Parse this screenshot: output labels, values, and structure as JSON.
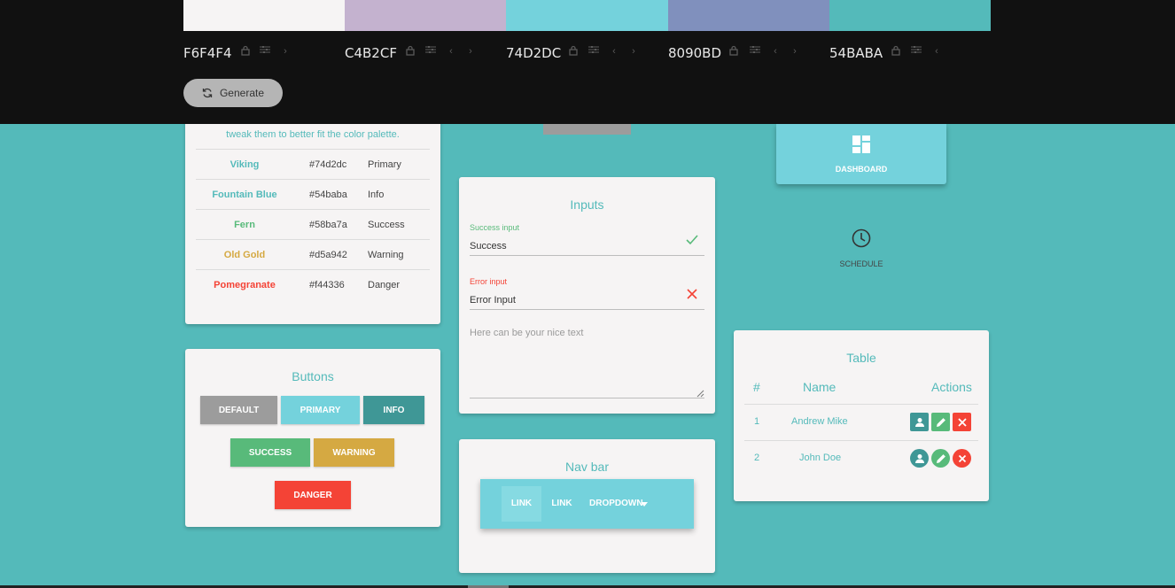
{
  "palette": [
    {
      "hex": "F6F4F4",
      "color": "#F6F4F4"
    },
    {
      "hex": "C4B2CF",
      "color": "#C4B2CF"
    },
    {
      "hex": "74D2DC",
      "color": "#74D2DC"
    },
    {
      "hex": "8090BD",
      "color": "#8090BD"
    },
    {
      "hex": "54BABA",
      "color": "#54BABA"
    }
  ],
  "generate_label": "Generate",
  "colors_card": {
    "intro": "tweak them to better fit the color palette.",
    "rows": [
      {
        "name": "Viking",
        "hex": "#74d2dc",
        "type": "Primary",
        "color": "#54BABA"
      },
      {
        "name": "Fountain Blue",
        "hex": "#54baba",
        "type": "Info",
        "color": "#54BABA"
      },
      {
        "name": "Fern",
        "hex": "#58ba7a",
        "type": "Success",
        "color": "#58BA7A"
      },
      {
        "name": "Old Gold",
        "hex": "#d5a942",
        "type": "Warning",
        "color": "#D5A942"
      },
      {
        "name": "Pomegranate",
        "hex": "#f44336",
        "type": "Danger",
        "color": "#F44336"
      }
    ]
  },
  "buttons_card": {
    "title": "Buttons",
    "default": "Default",
    "primary": "Primary",
    "info": "Info",
    "success": "Success",
    "warning": "Warning",
    "danger": "Danger"
  },
  "inputs_card": {
    "title": "Inputs",
    "success_label": "Success input",
    "success_value": "Success",
    "error_label": "Error input",
    "error_value": "Error Input",
    "textarea_placeholder": "Here can be your nice text"
  },
  "navbar_card": {
    "title": "Nav bar",
    "link1": "LINK",
    "link2": "LINK",
    "dropdown": "DROPDOWN"
  },
  "menu": {
    "dashboard": "DASHBOARD",
    "schedule": "SCHEDULE"
  },
  "table_card": {
    "title": "Table",
    "headers": [
      "#",
      "Name",
      "Actions"
    ],
    "rows": [
      {
        "num": "1",
        "name": "Andrew Mike"
      },
      {
        "num": "2",
        "name": "John Doe"
      }
    ]
  },
  "colors": {
    "dark": "#111111",
    "background": "#54BABA",
    "primary": "#74D2DC",
    "info": "#3F9796",
    "success": "#58BA7A",
    "warning": "#D5A942",
    "danger": "#F44336",
    "default": "#9C9C9C"
  }
}
